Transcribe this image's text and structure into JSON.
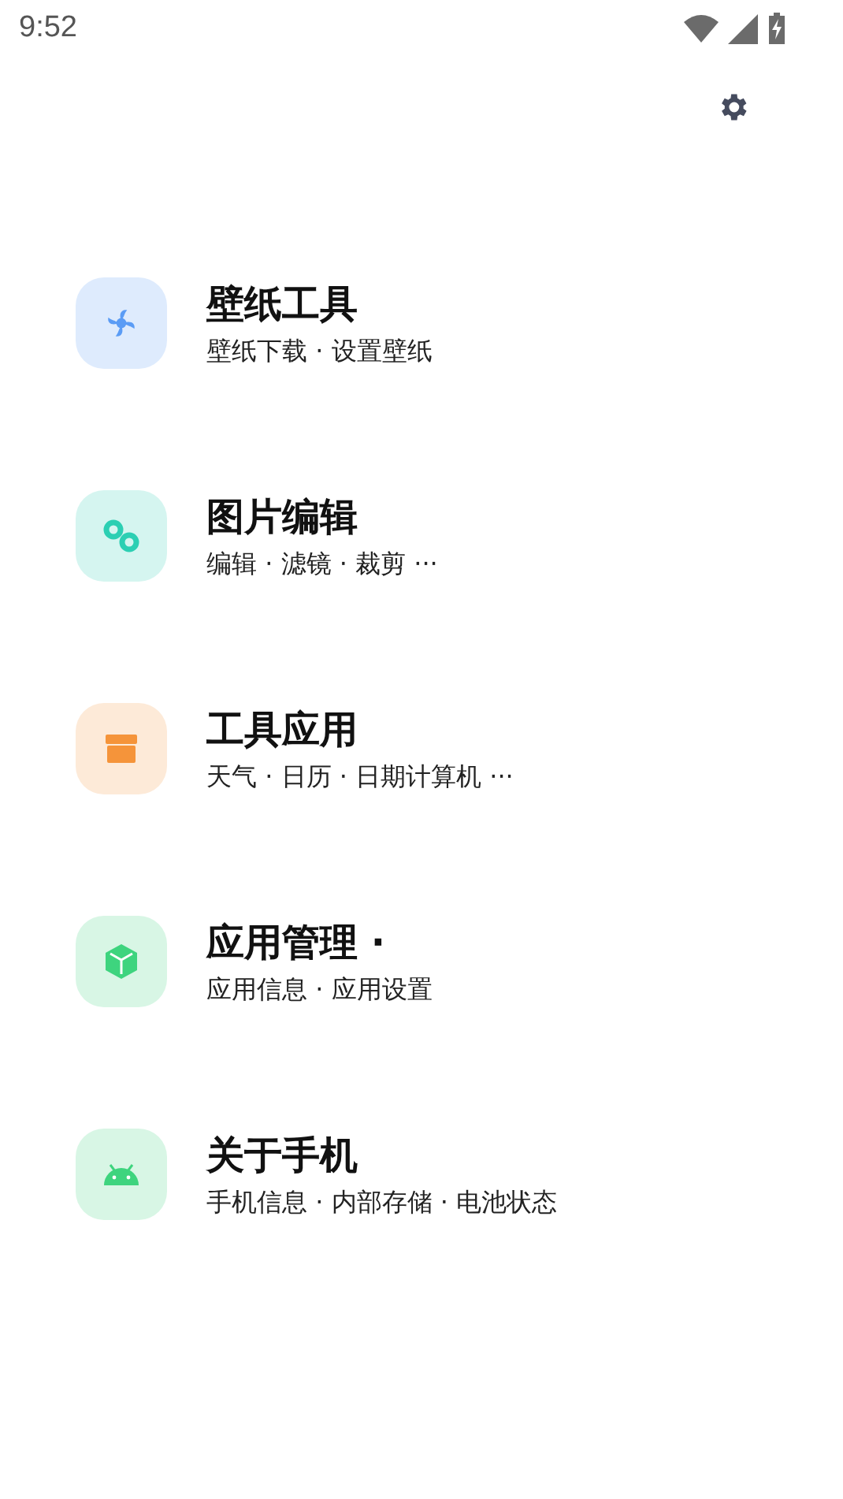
{
  "status_bar": {
    "time": "9:52"
  },
  "items": [
    {
      "kind": "fan",
      "color": "#5b9cf5",
      "title": "壁纸工具",
      "subtitle": "壁纸下载 · 设置壁纸"
    },
    {
      "kind": "gears",
      "color": "#2ccfb3",
      "title": "图片编辑",
      "subtitle": "编辑 · 滤镜 · 裁剪 ···"
    },
    {
      "kind": "box",
      "color": "#f5943a",
      "title": "工具应用",
      "subtitle": "天气 · 日历 · 日期计算机 ···"
    },
    {
      "kind": "cube",
      "color": "#3ed47e",
      "title": "应用管理 ·",
      "subtitle": "应用信息 · 应用设置"
    },
    {
      "kind": "android",
      "color": "#3ed47e",
      "title": "关于手机",
      "subtitle": "手机信息 · 内部存储 · 电池状态"
    }
  ]
}
